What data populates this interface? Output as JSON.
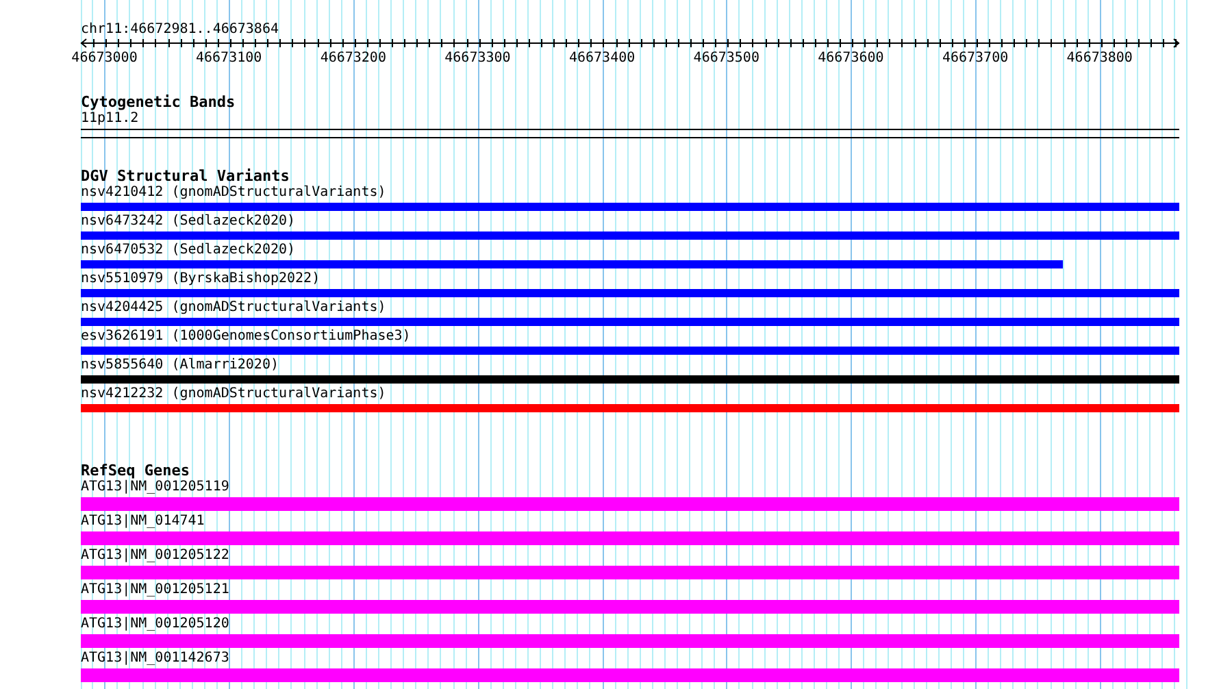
{
  "ruler": {
    "location": "chr11:46672981..46673864",
    "ticks": [
      "46673000",
      "46673100",
      "46673200",
      "46673300",
      "46673400",
      "46673500",
      "46673600",
      "46673700",
      "46673800"
    ]
  },
  "tracks": [
    {
      "kind": "band",
      "title": "Cytogenetic Bands",
      "features": [
        {
          "label": "11p11.2",
          "level": 1
        }
      ]
    },
    {
      "kind": "variant",
      "title": "DGV Structural Variants",
      "features": [
        {
          "label": "nsv4210412 (gnomADStructuralVariants)",
          "color": "#0000ff",
          "level": 1
        },
        {
          "label": "nsv6473242 (Sedlazeck2020)",
          "color": "#0000ff",
          "level": 1
        },
        {
          "label": "nsv6470532 (Sedlazeck2020)",
          "color": "#0000ff",
          "level": 0.894
        },
        {
          "label": "nsv5510979 (ByrskaBishop2022)",
          "color": "#0000ff",
          "level": 1
        },
        {
          "label": "nsv4204425 (gnomADStructuralVariants)",
          "color": "#0000ff",
          "level": 1
        },
        {
          "label": "esv3626191 (1000GenomesConsortiumPhase3)",
          "color": "#0000ff",
          "level": 1
        },
        {
          "label": "nsv5855640 (Almarri2020)",
          "color": "#000000",
          "level": 1
        },
        {
          "label": "nsv4212232 (gnomADStructuralVariants)",
          "color": "#ff0000",
          "level": 1
        }
      ]
    },
    {
      "kind": "gene",
      "title": "RefSeq Genes",
      "features": [
        {
          "label": "ATG13|NM_001205119",
          "level": 1
        },
        {
          "label": "ATG13|NM_014741",
          "level": 1
        },
        {
          "label": "ATG13|NM_001205122",
          "level": 1
        },
        {
          "label": "ATG13|NM_001205121",
          "level": 1
        },
        {
          "label": "ATG13|NM_001205120",
          "level": 1
        },
        {
          "label": "ATG13|NM_001142673",
          "level": 1
        }
      ]
    }
  ]
}
